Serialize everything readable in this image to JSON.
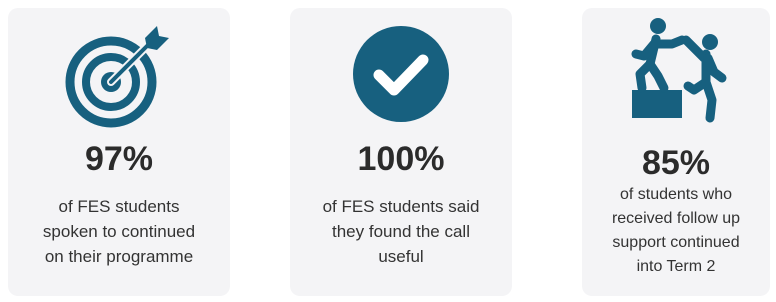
{
  "colors": {
    "accent": "#17607f",
    "card_background": "#f4f4f6",
    "text": "#2b2b2b"
  },
  "stats": [
    {
      "icon": "target-icon",
      "value": "97%",
      "lines": [
        "of FES students",
        "spoken to continued",
        "on their programme"
      ]
    },
    {
      "icon": "checkmark-circle-icon",
      "value": "100%",
      "lines": [
        "of FES students said",
        "they found the call",
        "useful"
      ]
    },
    {
      "icon": "helping-hand-icon",
      "value": "85%",
      "lines": [
        "of students who",
        "received follow up",
        "support continued",
        "into Term 2"
      ]
    }
  ]
}
